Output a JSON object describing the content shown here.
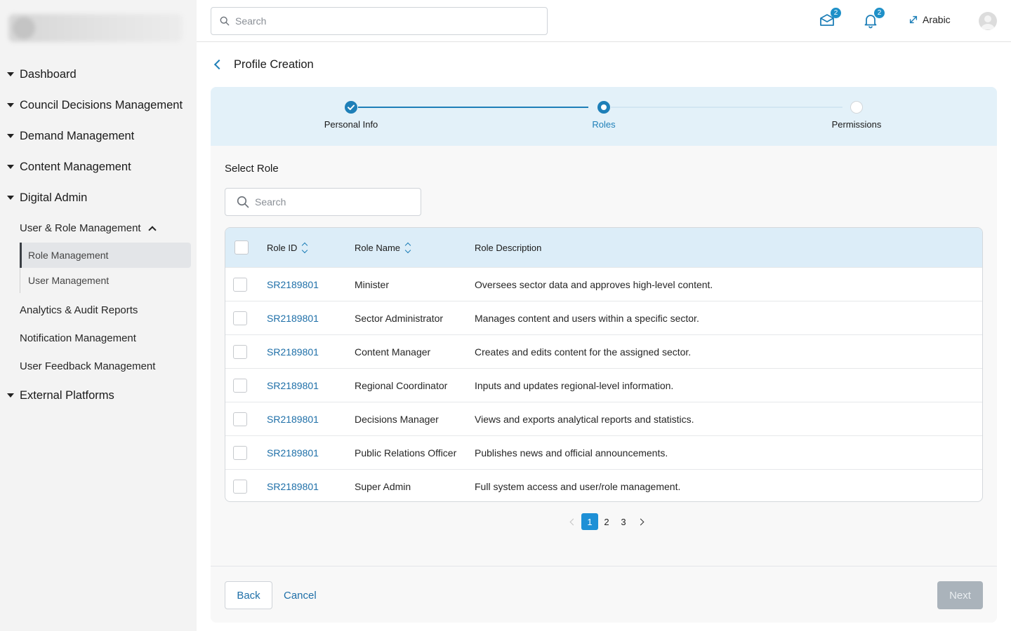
{
  "sidebar": {
    "nav": [
      {
        "label": "Dashboard"
      },
      {
        "label": "Council Decisions Management"
      },
      {
        "label": "Demand Management"
      },
      {
        "label": "Content Management"
      },
      {
        "label": "Digital Admin"
      }
    ],
    "digital_admin": {
      "group_label": "User & Role Management",
      "sub_items": [
        {
          "label": "Role Management",
          "active": true
        },
        {
          "label": "User Management",
          "active": false
        }
      ],
      "items": [
        {
          "label": "Analytics & Audit Reports"
        },
        {
          "label": "Notification Management"
        },
        {
          "label": "User Feedback Management"
        }
      ]
    },
    "external": {
      "label": "External Platforms"
    }
  },
  "header": {
    "search_placeholder": "Search",
    "mail_badge": "2",
    "bell_badge": "2",
    "language": "Arabic"
  },
  "page": {
    "title": "Profile Creation"
  },
  "stepper": {
    "steps": [
      {
        "label": "Personal Info",
        "state": "done"
      },
      {
        "label": "Roles",
        "state": "active"
      },
      {
        "label": "Permissions",
        "state": "pending"
      }
    ]
  },
  "roles": {
    "section_title": "Select Role",
    "search_placeholder": "Search",
    "columns": {
      "id": "Role ID",
      "name": "Role Name",
      "description": "Role Description"
    },
    "rows": [
      {
        "id": "SR2189801",
        "name": "Minister",
        "description": "Oversees sector data and approves high-level content."
      },
      {
        "id": "SR2189801",
        "name": "Sector Administrator",
        "description": "Manages content and users within a specific sector."
      },
      {
        "id": "SR2189801",
        "name": "Content Manager",
        "description": "Creates and edits content for the assigned sector."
      },
      {
        "id": "SR2189801",
        "name": "Regional Coordinator",
        "description": "Inputs and updates regional-level information."
      },
      {
        "id": "SR2189801",
        "name": "Decisions Manager",
        "description": "Views and exports analytical reports and statistics."
      },
      {
        "id": "SR2189801",
        "name": "Public Relations Officer",
        "description": "Publishes news and official announcements."
      },
      {
        "id": "SR2189801",
        "name": "Super Admin",
        "description": "Full system access and user/role management."
      }
    ]
  },
  "pagination": {
    "pages": [
      "1",
      "2",
      "3"
    ],
    "current": "1"
  },
  "footer": {
    "back_label": "Back",
    "cancel_label": "Cancel",
    "next_label": "Next"
  },
  "colors": {
    "accent": "#1e7fb8",
    "stepper_bg": "#e3f1f9",
    "table_header_bg": "#dcedf8",
    "next_disabled": "#aab3bb"
  }
}
